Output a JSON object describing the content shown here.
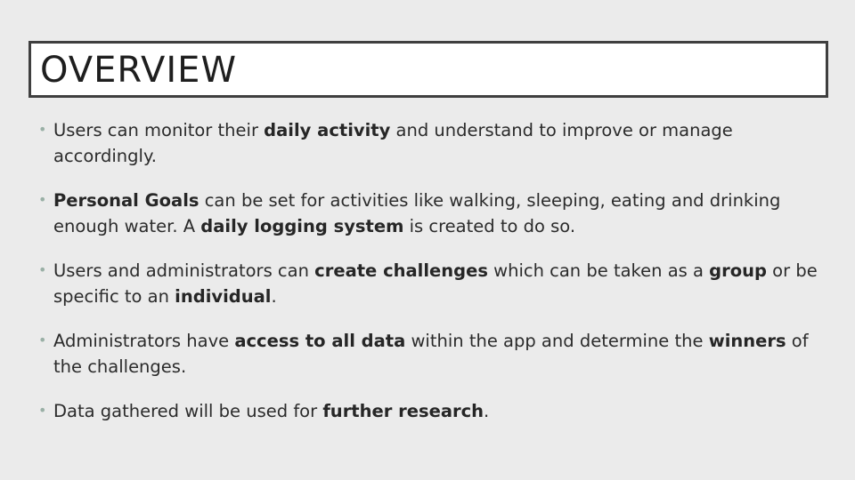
{
  "slide": {
    "title": "OVERVIEW",
    "bullet_marker": "•",
    "bullets": [
      {
        "parts": [
          {
            "text": "Users can monitor their ",
            "bold": false
          },
          {
            "text": "daily activity",
            "bold": true
          },
          {
            "text": " and understand to improve or manage accordingly.",
            "bold": false
          }
        ]
      },
      {
        "parts": [
          {
            "text": "Personal Goals",
            "bold": true
          },
          {
            "text": " can be set for activities like walking, sleeping, eating and drinking enough water.  A ",
            "bold": false
          },
          {
            "text": "daily logging system",
            "bold": true
          },
          {
            "text": " is created to do so.",
            "bold": false
          }
        ]
      },
      {
        "parts": [
          {
            "text": " Users and administrators can ",
            "bold": false
          },
          {
            "text": "create challenges",
            "bold": true
          },
          {
            "text": " which can be taken as a ",
            "bold": false
          },
          {
            "text": "group",
            "bold": true
          },
          {
            "text": "  or be specific to an ",
            "bold": false
          },
          {
            "text": "individual",
            "bold": true
          },
          {
            "text": ".",
            "bold": false
          }
        ]
      },
      {
        "parts": [
          {
            "text": "Administrators have ",
            "bold": false
          },
          {
            "text": "access to all data",
            "bold": true
          },
          {
            "text": " within the app and determine the ",
            "bold": false
          },
          {
            "text": "winners",
            "bold": true
          },
          {
            "text": " of the challenges.",
            "bold": false
          }
        ]
      },
      {
        "parts": [
          {
            "text": "Data gathered will be used for ",
            "bold": false
          },
          {
            "text": "further research",
            "bold": true
          },
          {
            "text": ".",
            "bold": false
          }
        ]
      }
    ],
    "colors": {
      "background": "#ebebeb",
      "title_border": "#3f3f3f",
      "bullet_marker": "#9ab0a6"
    }
  }
}
